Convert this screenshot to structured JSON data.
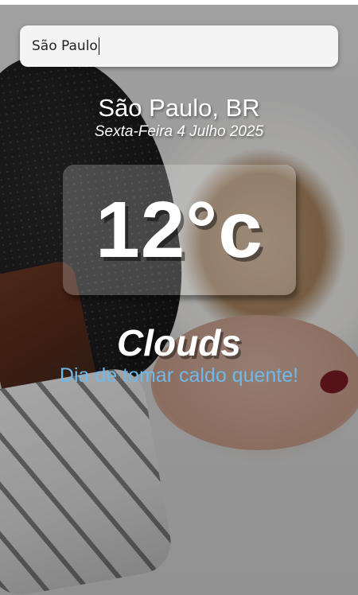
{
  "search": {
    "value": "São Paulo"
  },
  "location": {
    "label": "São Paulo, BR"
  },
  "date": {
    "label": "Sexta-Feira 4 Julho 2025"
  },
  "temperature": {
    "value": "12°c"
  },
  "weather": {
    "condition": "Clouds",
    "message": "Dia de tomar caldo quente!"
  },
  "colors": {
    "message": "#6fb8ea",
    "text": "#ffffff",
    "search_bg": "#f4f4f4"
  },
  "background": {
    "description_icon": "coffee-cup-background-image"
  }
}
